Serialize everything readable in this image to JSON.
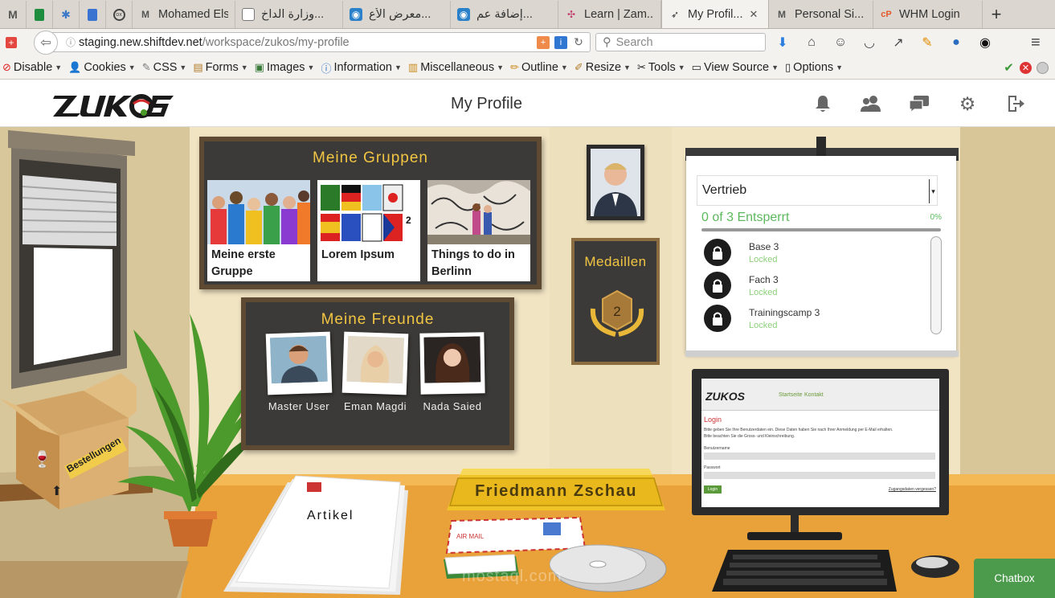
{
  "browser": {
    "pinned_tabs": [
      "gmail",
      "sheets",
      "pinwheel",
      "docs",
      "olx"
    ],
    "tabs": [
      {
        "label": "Mohamed Elsa...",
        "icon": "gmail-icon",
        "active": false
      },
      {
        "label": "وزارة الداخ...",
        "icon": "page-icon",
        "active": false
      },
      {
        "label": "معرض الأع...",
        "icon": "mostaql-icon",
        "active": false
      },
      {
        "label": "إضافة عم...",
        "icon": "mostaql-icon",
        "active": false
      },
      {
        "label": "Learn | Zam...",
        "icon": "slack-icon",
        "active": false
      },
      {
        "label": "My Profil...",
        "icon": "zukos-icon",
        "active": true
      },
      {
        "label": "Personal Si...",
        "icon": "gmail-icon",
        "active": false
      },
      {
        "label": "WHM Login",
        "icon": "cpanel-icon",
        "active": false
      }
    ],
    "url": {
      "host": "staging.new.shiftdev.net",
      "path": "/workspace/zukos/my-profile"
    },
    "search_placeholder": "Search"
  },
  "devtoolbar": {
    "items": [
      "Disable",
      "Cookies",
      "CSS",
      "Forms",
      "Images",
      "Information",
      "Miscellaneous",
      "Outline",
      "Resize",
      "Tools",
      "View Source",
      "Options"
    ]
  },
  "header": {
    "title": "My Profile",
    "icons": [
      "bell-icon",
      "users-icon",
      "chat-icon",
      "settings-icon",
      "logout-icon"
    ]
  },
  "groups": {
    "title": "Meine Gruppen",
    "items": [
      "Meine erste Gruppe",
      "Lorem Ipsum",
      "Things to do in Berlinn"
    ]
  },
  "friends": {
    "title": "Meine Freunde",
    "items": [
      "Master User",
      "Eman Magdi",
      "Nada Saied"
    ]
  },
  "medals": {
    "title": "Medaillen",
    "level": "2"
  },
  "progress": {
    "select_value": "Vertrieb",
    "unlock_text": "0 of 3 Entsperrt",
    "unlock_pct": "0%",
    "percent": 0,
    "items": [
      {
        "name": "Base 3",
        "status": "Locked"
      },
      {
        "name": "Fach 3",
        "status": "Locked"
      },
      {
        "name": "Trainingscamp 3",
        "status": "Locked"
      }
    ]
  },
  "monitor": {
    "nav": [
      "Startseite",
      "Kontakt"
    ],
    "login_title": "Login",
    "login_text": "Bitte geben Sie Ihre Benutzerdaten ein. Diese Daten haben Sie nach Ihrer Anmeldung per E-Mail erhalten.",
    "login_text2": "Bitte beachten Sie die Gross- und Kleinschreibung.",
    "username_label": "Benutzername",
    "password_label": "Passwort",
    "login_button": "Login",
    "forgot": "Zugangsdaten vergessen?"
  },
  "desk": {
    "nameplate": "Friedmann Zschau",
    "papers_label": "Artikel",
    "box_label": "Bestellungen",
    "airmail": "AIR MAIL"
  },
  "watermark": "mostaql.com",
  "chatbox": "Chatbox",
  "colors": {
    "accent_green": "#5cb85c",
    "chalk_gold": "#f2c542",
    "desk": "#e9a23a"
  }
}
